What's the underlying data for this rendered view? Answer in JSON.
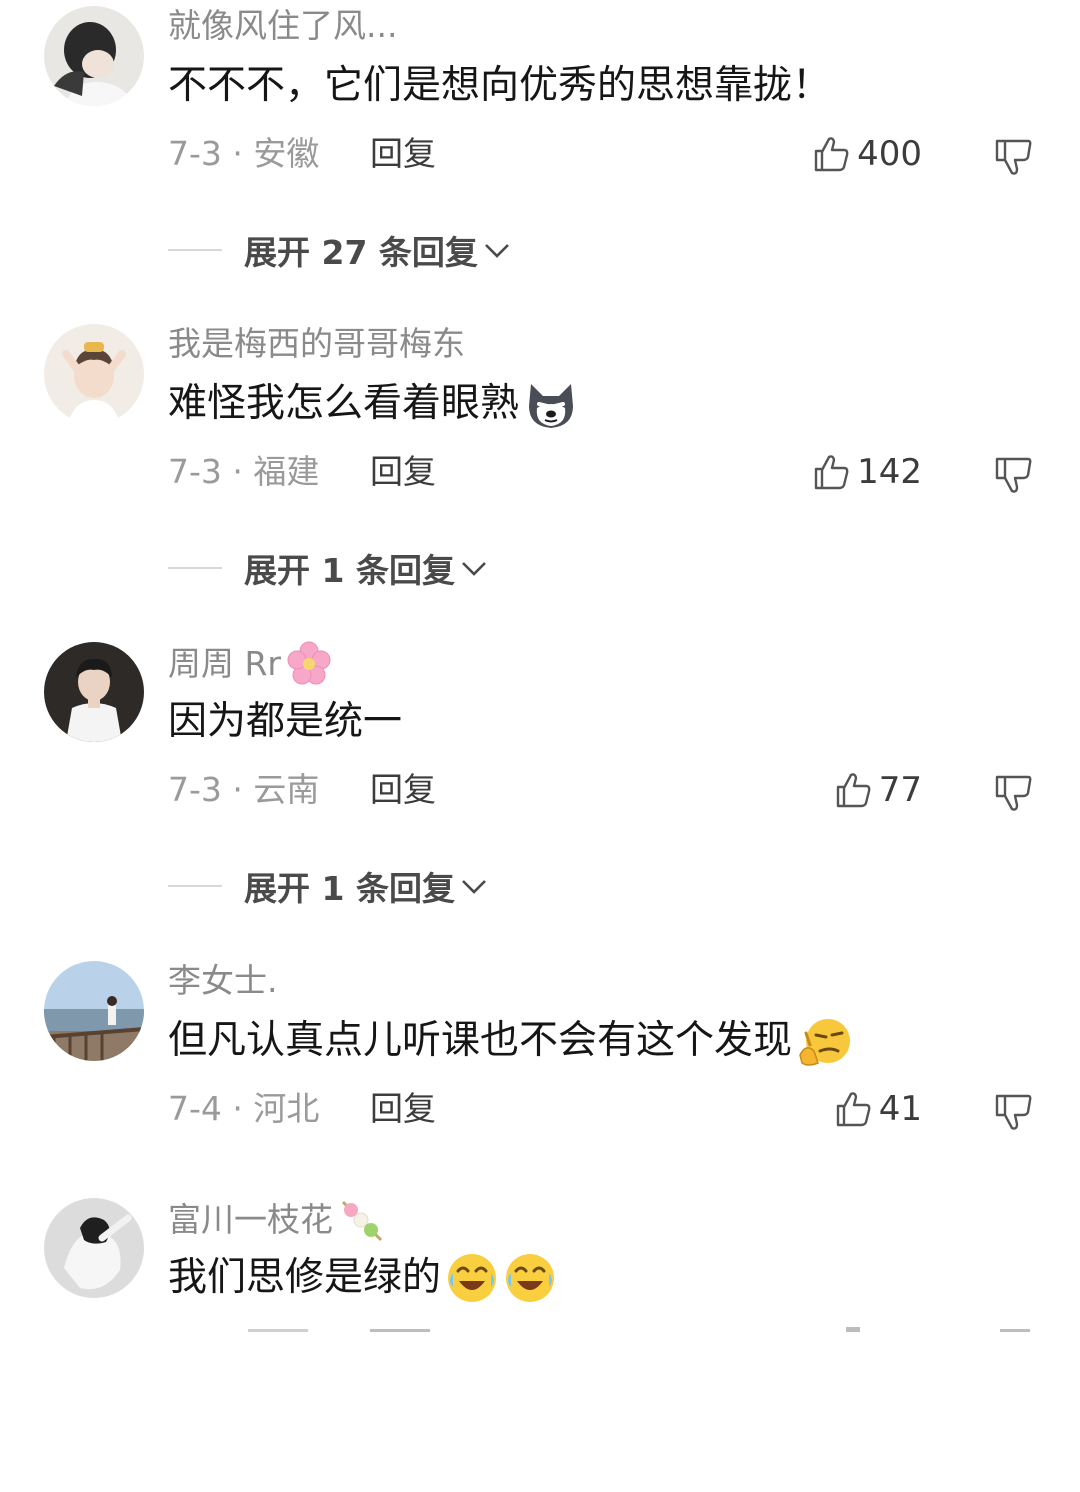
{
  "comments": [
    {
      "username": "就像风住了风...",
      "text": "不不不，它们是想向优秀的思想靠拢！",
      "date_location": "7-3 · 安徽",
      "reply_label": "回复",
      "likes": "400",
      "expand_label": "展开 27 条回复",
      "avatar_icon": "avatar-person-dark-hair"
    },
    {
      "username": "我是梅西的哥哥梅东",
      "text": "难怪我怎么看着眼熟",
      "emoji": "husky-dog-icon",
      "date_location": "7-3 · 福建",
      "reply_label": "回复",
      "likes": "142",
      "expand_label": "展开 1 条回复",
      "avatar_icon": "avatar-child"
    },
    {
      "username": "周周 Rr",
      "username_emoji": "cherry-blossom-icon",
      "text": "因为都是统一",
      "date_location": "7-3 · 云南",
      "reply_label": "回复",
      "likes": "77",
      "expand_label": "展开 1 条回复",
      "avatar_icon": "avatar-young-man"
    },
    {
      "username": "李女士.",
      "text": "但凡认真点儿听课也不会有这个发现",
      "emoji": "thinking-smirk-icon",
      "date_location": "7-4 · 河北",
      "reply_label": "回复",
      "likes": "41",
      "avatar_icon": "avatar-seaside"
    },
    {
      "username": "富川一枝花",
      "username_emoji": "dango-icon",
      "text": "我们思修是绿的",
      "emoji": "laugh-cry-icon",
      "avatar_icon": "avatar-person-sketch"
    }
  ],
  "colors": {
    "username": "#8a8a8a",
    "text": "#161616",
    "meta": "#9a9a9a",
    "action": "#3c3c3c"
  }
}
